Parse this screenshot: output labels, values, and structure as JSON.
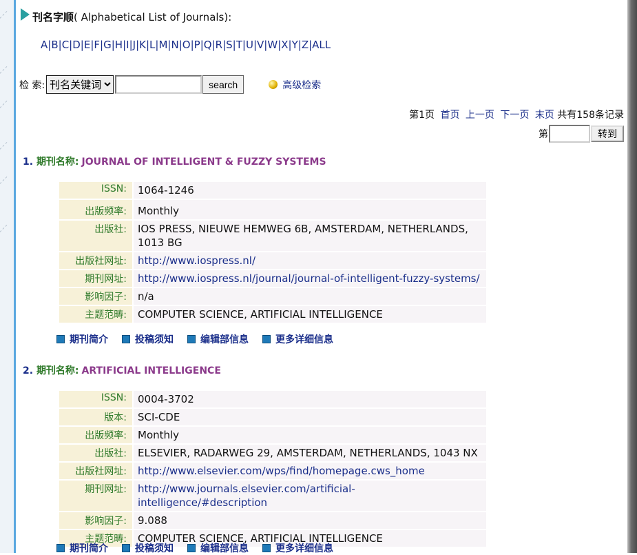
{
  "heading": {
    "bold": "刊名字顺",
    "rest": "( Alphabetical List of Journals):"
  },
  "alphabet": [
    "A",
    "B",
    "C",
    "D",
    "E",
    "F",
    "G",
    "H",
    "I",
    "J",
    "K",
    "L",
    "M",
    "N",
    "O",
    "P",
    "Q",
    "R",
    "S",
    "T",
    "U",
    "V",
    "W",
    "X",
    "Y",
    "Z",
    "ALL"
  ],
  "search": {
    "label": "检 索:",
    "select_value": "刊名关键词",
    "input_value": "",
    "button": "search",
    "advanced": "高级检索"
  },
  "pager": {
    "current": "第1页",
    "first": "首页",
    "prev": "上一页",
    "next": "下一页",
    "last": "末页",
    "total": "共有158条记录",
    "goto_prefix": "第",
    "goto_value": "",
    "goto_button": "转到"
  },
  "field_labels": {
    "issn": "ISSN:",
    "edition": "版本:",
    "frequency": "出版频率:",
    "publisher": "出版社:",
    "publisher_url": "出版社网址:",
    "journal_url": "期刊网址:",
    "impact": "影响因子:",
    "subject": "主题范畴:"
  },
  "title_label": "期刊名称:",
  "action_labels": [
    "期刊简介",
    "投稿须知",
    "编辑部信息",
    "更多详细信息"
  ],
  "entries": [
    {
      "num": "1.",
      "name": "JOURNAL OF INTELLIGENT & FUZZY SYSTEMS",
      "issn": "1064-1246",
      "frequency": "Monthly",
      "publisher": "IOS PRESS, NIEUWE HEMWEG 6B, AMSTERDAM, NETHERLANDS, 1013 BG",
      "publisher_url": "http://www.iospress.nl/",
      "journal_url": "http://www.iospress.nl/journal/journal-of-intelligent-fuzzy-systems/",
      "impact": "n/a",
      "subject": "COMPUTER SCIENCE, ARTIFICIAL INTELLIGENCE"
    },
    {
      "num": "2.",
      "name": "ARTIFICIAL INTELLIGENCE",
      "issn": "0004-3702",
      "edition": "SCI-CDE",
      "frequency": "Monthly",
      "publisher": "ELSEVIER, RADARWEG 29, AMSTERDAM, NETHERLANDS, 1043 NX",
      "publisher_url": "http://www.elsevier.com/wps/find/homepage.cws_home",
      "journal_url": "http://www.journals.elsevier.com/artificial-intelligence/#description",
      "impact": "9.088",
      "subject": "COMPUTER SCIENCE, ARTIFICIAL INTELLIGENCE"
    }
  ]
}
